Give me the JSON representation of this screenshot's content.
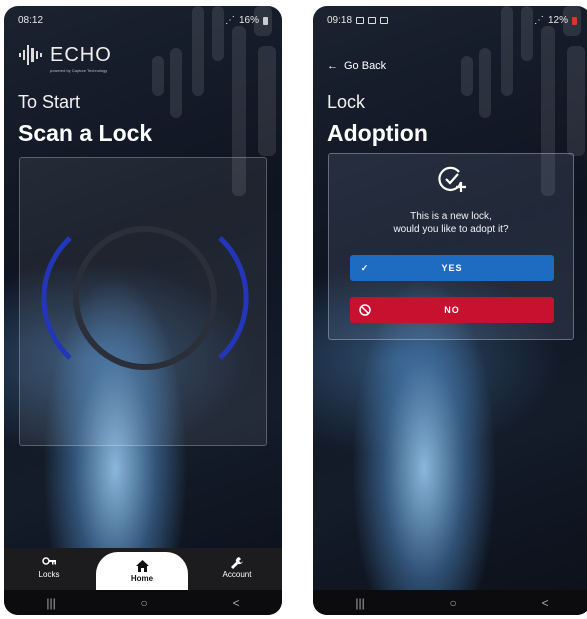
{
  "left": {
    "status": {
      "time": "08:12",
      "battery": "16%"
    },
    "logo": {
      "name": "ECHO",
      "tagline": "powered by Capture Technology"
    },
    "heading_small": "To Start",
    "heading_big": "Scan a Lock",
    "nav": {
      "locks": "Locks",
      "home": "Home",
      "account": "Account"
    }
  },
  "right": {
    "status": {
      "time": "09:18",
      "battery": "12%"
    },
    "go_back": "Go Back",
    "heading_small": "Lock",
    "heading_big": "Adoption",
    "question_line1": "This is a new lock,",
    "question_line2": "would you like to adopt it?",
    "yes_label": "YES",
    "no_label": "NO"
  },
  "system_nav": {
    "recents": "|||",
    "home": "○",
    "back": "<"
  },
  "colors": {
    "yes": "#1e6bc2",
    "no": "#c7112f",
    "ring": "#2a2f3a",
    "arc": "#2436b8"
  }
}
